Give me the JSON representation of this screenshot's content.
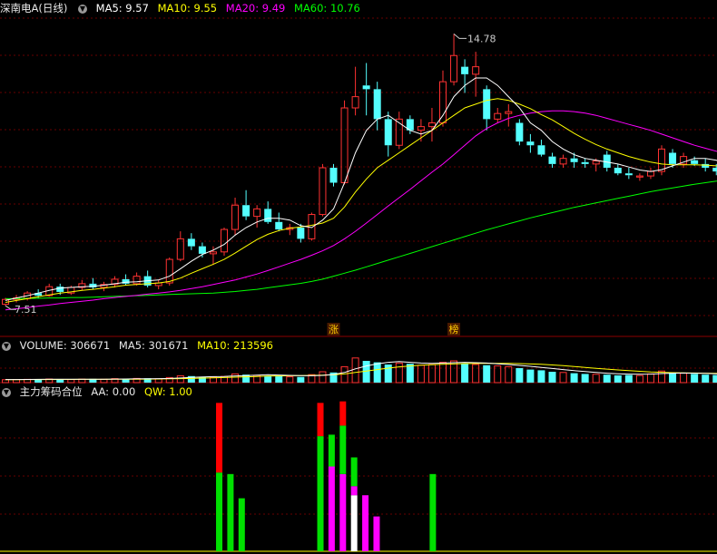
{
  "main_panel": {
    "title": "深南电A(日线)",
    "ma5": "MA5: 9.57",
    "ma10": "MA10: 9.55",
    "ma20": "MA20: 9.49",
    "ma60": "MA60: 10.76",
    "high_label": "14.78",
    "low_label": "7.51",
    "markers": [
      "涨",
      "榜"
    ]
  },
  "volume_panel": {
    "label": "VOLUME: 306671",
    "ma5": "MA5: 301671",
    "ma10": "MA10: 213596"
  },
  "chip_panel": {
    "title": "主力筹码合位",
    "aa": "AA: 0.00",
    "qw": "QW: 1.00"
  },
  "colors": {
    "up": "#ff3232",
    "down": "#54ffff",
    "ma5": "#ffffff",
    "ma10": "#ffff00",
    "ma20": "#ff00ff",
    "ma60": "#00ff00",
    "grid": "#8b0000",
    "chip_red": "#ff0000",
    "chip_green": "#00e000",
    "chip_magenta": "#ff00ff",
    "chip_white": "#ffffff"
  },
  "chart_data": [
    {
      "type": "candlestick",
      "title": "深南电A(日线)",
      "ylim": [
        7.2,
        15.2
      ],
      "high": 14.78,
      "low": 7.51,
      "marker_labels": [
        {
          "text": "涨",
          "index": 30
        },
        {
          "text": "榜",
          "index": 41
        }
      ],
      "ohlc": [
        [
          7.55,
          7.72,
          7.51,
          7.68
        ],
        [
          7.68,
          7.8,
          7.6,
          7.72
        ],
        [
          7.7,
          7.9,
          7.65,
          7.85
        ],
        [
          7.85,
          7.95,
          7.7,
          7.78
        ],
        [
          7.78,
          8.1,
          7.75,
          8.02
        ],
        [
          8.02,
          8.1,
          7.8,
          7.88
        ],
        [
          7.85,
          8.05,
          7.8,
          8.0
        ],
        [
          8.0,
          8.2,
          7.92,
          8.1
        ],
        [
          8.1,
          8.25,
          7.95,
          8.0
        ],
        [
          8.0,
          8.15,
          7.9,
          8.08
        ],
        [
          8.08,
          8.3,
          8.0,
          8.22
        ],
        [
          8.22,
          8.35,
          8.05,
          8.1
        ],
        [
          8.1,
          8.4,
          8.05,
          8.3
        ],
        [
          8.3,
          8.45,
          8.0,
          8.05
        ],
        [
          8.05,
          8.2,
          7.95,
          8.12
        ],
        [
          8.12,
          8.8,
          8.05,
          8.75
        ],
        [
          8.75,
          9.5,
          8.7,
          9.3
        ],
        [
          9.3,
          9.45,
          9.0,
          9.1
        ],
        [
          9.1,
          9.2,
          8.8,
          8.9
        ],
        [
          8.9,
          9.1,
          8.6,
          8.95
        ],
        [
          8.95,
          9.6,
          8.85,
          9.55
        ],
        [
          9.55,
          10.4,
          9.4,
          10.2
        ],
        [
          10.2,
          10.6,
          9.8,
          9.9
        ],
        [
          9.9,
          10.2,
          9.6,
          10.1
        ],
        [
          10.1,
          10.3,
          9.7,
          9.75
        ],
        [
          9.75,
          10.0,
          9.5,
          9.55
        ],
        [
          9.55,
          9.7,
          9.4,
          9.6
        ],
        [
          9.6,
          9.7,
          9.2,
          9.3
        ],
        [
          9.3,
          10.0,
          9.25,
          9.95
        ],
        [
          9.95,
          11.3,
          9.9,
          11.2
        ],
        [
          11.2,
          11.3,
          10.7,
          10.8
        ],
        [
          10.8,
          13.0,
          10.75,
          12.8
        ],
        [
          12.8,
          13.9,
          12.6,
          13.1
        ],
        [
          13.4,
          14.0,
          12.6,
          13.3
        ],
        [
          13.3,
          13.5,
          12.2,
          12.5
        ],
        [
          12.5,
          12.7,
          11.5,
          11.8
        ],
        [
          11.8,
          12.7,
          11.7,
          12.5
        ],
        [
          12.5,
          12.6,
          12.1,
          12.2
        ],
        [
          12.2,
          12.5,
          11.9,
          12.3
        ],
        [
          12.3,
          12.8,
          11.9,
          12.4
        ],
        [
          12.4,
          13.8,
          12.3,
          13.5
        ],
        [
          13.5,
          14.78,
          13.4,
          14.2
        ],
        [
          13.9,
          14.1,
          13.2,
          13.7
        ],
        [
          13.7,
          14.3,
          13.1,
          13.9
        ],
        [
          13.3,
          13.4,
          12.2,
          12.5
        ],
        [
          12.5,
          12.8,
          12.4,
          12.65
        ],
        [
          12.65,
          12.9,
          12.3,
          12.7
        ],
        [
          12.4,
          12.5,
          11.8,
          11.9
        ],
        [
          11.9,
          12.1,
          11.6,
          11.8
        ],
        [
          11.8,
          11.95,
          11.5,
          11.55
        ],
        [
          11.5,
          11.6,
          11.2,
          11.3
        ],
        [
          11.3,
          11.55,
          11.2,
          11.45
        ],
        [
          11.45,
          11.6,
          11.2,
          11.35
        ],
        [
          11.35,
          11.45,
          11.2,
          11.3
        ],
        [
          11.3,
          11.45,
          11.1,
          11.38
        ],
        [
          11.55,
          11.65,
          11.1,
          11.2
        ],
        [
          11.2,
          11.3,
          11.0,
          11.05
        ],
        [
          11.05,
          11.2,
          10.9,
          11.0
        ],
        [
          10.95,
          11.05,
          10.85,
          10.98
        ],
        [
          10.98,
          11.2,
          10.9,
          11.1
        ],
        [
          11.1,
          11.8,
          11.0,
          11.7
        ],
        [
          11.6,
          11.7,
          11.2,
          11.3
        ],
        [
          11.3,
          11.6,
          11.2,
          11.5
        ],
        [
          11.4,
          11.5,
          11.25,
          11.3
        ],
        [
          11.3,
          11.45,
          11.1,
          11.2
        ],
        [
          11.2,
          11.3,
          11.0,
          11.1
        ],
        [
          11.0,
          11.05,
          10.7,
          10.75
        ],
        [
          10.75,
          10.9,
          10.6,
          10.82
        ],
        [
          10.72,
          10.8,
          10.5,
          10.55
        ],
        [
          10.55,
          10.7,
          10.45,
          10.65
        ],
        [
          10.6,
          10.65,
          10.4,
          10.45
        ],
        [
          10.35,
          10.45,
          10.25,
          10.3
        ],
        [
          10.3,
          10.55,
          10.25,
          10.5
        ]
      ],
      "ma5": [
        7.65,
        7.72,
        7.78,
        7.85,
        7.92,
        7.98,
        8.0,
        8.02,
        8.03,
        8.06,
        8.1,
        8.14,
        8.15,
        8.18,
        8.2,
        8.3,
        8.5,
        8.7,
        8.88,
        9.0,
        9.15,
        9.4,
        9.6,
        9.75,
        9.85,
        9.85,
        9.8,
        9.65,
        9.6,
        9.8,
        10.1,
        10.8,
        11.6,
        12.2,
        12.5,
        12.6,
        12.4,
        12.2,
        12.1,
        12.2,
        12.6,
        13.1,
        13.4,
        13.6,
        13.6,
        13.4,
        13.1,
        12.8,
        12.4,
        12.2,
        11.9,
        11.7,
        11.55,
        11.45,
        11.4,
        11.35,
        11.3,
        11.22,
        11.14,
        11.1,
        11.15,
        11.25,
        11.35,
        11.45,
        11.45,
        11.4,
        11.22,
        11.05,
        10.95,
        10.85,
        10.72,
        10.62,
        10.58
      ],
      "ma10": [
        7.6,
        7.65,
        7.7,
        7.75,
        7.8,
        7.85,
        7.88,
        7.92,
        7.95,
        7.98,
        8.02,
        8.06,
        8.08,
        8.1,
        8.12,
        8.16,
        8.25,
        8.38,
        8.5,
        8.62,
        8.75,
        8.92,
        9.1,
        9.28,
        9.42,
        9.52,
        9.58,
        9.62,
        9.66,
        9.72,
        9.85,
        10.15,
        10.55,
        10.9,
        11.2,
        11.4,
        11.6,
        11.8,
        12.0,
        12.2,
        12.4,
        12.6,
        12.8,
        12.9,
        13.0,
        13.05,
        13.0,
        12.9,
        12.78,
        12.62,
        12.48,
        12.3,
        12.12,
        11.96,
        11.82,
        11.7,
        11.6,
        11.5,
        11.42,
        11.35,
        11.3,
        11.28,
        11.28,
        11.28,
        11.27,
        11.25,
        11.22,
        11.18,
        11.12,
        11.05,
        10.98,
        10.9,
        10.82
      ],
      "ma20": [
        7.4,
        7.43,
        7.46,
        7.5,
        7.53,
        7.57,
        7.6,
        7.63,
        7.66,
        7.7,
        7.73,
        7.76,
        7.79,
        7.82,
        7.85,
        7.88,
        7.92,
        7.97,
        8.02,
        8.08,
        8.14,
        8.2,
        8.28,
        8.36,
        8.45,
        8.55,
        8.65,
        8.75,
        8.86,
        8.98,
        9.12,
        9.3,
        9.5,
        9.72,
        9.95,
        10.18,
        10.4,
        10.62,
        10.85,
        11.08,
        11.3,
        11.55,
        11.8,
        12.05,
        12.25,
        12.4,
        12.52,
        12.6,
        12.66,
        12.7,
        12.72,
        12.72,
        12.7,
        12.66,
        12.6,
        12.52,
        12.44,
        12.36,
        12.28,
        12.2,
        12.1,
        12.0,
        11.9,
        11.8,
        11.72,
        11.64,
        11.56,
        11.48,
        11.4,
        11.32,
        11.26,
        11.2,
        11.16
      ],
      "ma60": [
        7.7,
        7.7,
        7.71,
        7.71,
        7.72,
        7.72,
        7.73,
        7.73,
        7.74,
        7.75,
        7.76,
        7.77,
        7.78,
        7.79,
        7.8,
        7.81,
        7.82,
        7.83,
        7.84,
        7.85,
        7.87,
        7.89,
        7.92,
        7.95,
        7.99,
        8.03,
        8.07,
        8.11,
        8.16,
        8.22,
        8.3,
        8.38,
        8.46,
        8.55,
        8.64,
        8.73,
        8.82,
        8.91,
        9.0,
        9.09,
        9.18,
        9.27,
        9.36,
        9.45,
        9.54,
        9.62,
        9.7,
        9.78,
        9.86,
        9.93,
        10.0,
        10.07,
        10.14,
        10.2,
        10.26,
        10.32,
        10.38,
        10.44,
        10.5,
        10.56,
        10.61,
        10.66,
        10.71,
        10.76,
        10.8,
        10.84,
        10.88,
        10.91,
        10.94,
        10.96,
        10.98,
        10.99,
        11.0
      ]
    },
    {
      "type": "bar",
      "title": "VOLUME",
      "ylim": [
        0,
        400000
      ],
      "values": [
        40000,
        42000,
        45000,
        38000,
        50000,
        44000,
        42000,
        48000,
        52000,
        46000,
        55000,
        50000,
        58000,
        60000,
        52000,
        70000,
        95000,
        90000,
        80000,
        75000,
        85000,
        120000,
        110000,
        100000,
        95000,
        90000,
        80000,
        78000,
        110000,
        150000,
        140000,
        220000,
        340000,
        300000,
        280000,
        250000,
        270000,
        260000,
        240000,
        250000,
        280000,
        300000,
        260000,
        250000,
        240000,
        230000,
        220000,
        200000,
        180000,
        170000,
        150000,
        140000,
        130000,
        120000,
        115000,
        110000,
        100000,
        105000,
        98000,
        120000,
        160000,
        140000,
        130000,
        120000,
        110000,
        105000,
        100000,
        95000,
        90000,
        85000,
        80000,
        78000,
        75000
      ],
      "ma5": [
        42000,
        43000,
        44000,
        45000,
        46000,
        46000,
        46000,
        47000,
        48000,
        48000,
        49000,
        50000,
        52000,
        54000,
        55000,
        58000,
        64000,
        72000,
        78000,
        82000,
        85000,
        92000,
        98000,
        104000,
        110000,
        105000,
        100000,
        96000,
        95000,
        100000,
        112000,
        140000,
        190000,
        230000,
        260000,
        280000,
        290000,
        280000,
        270000,
        265000,
        270000,
        275000,
        280000,
        275000,
        270000,
        260000,
        250000,
        238000,
        225000,
        210000,
        195000,
        180000,
        165000,
        152000,
        140000,
        130000,
        122000,
        118000,
        115000,
        118000,
        125000,
        130000,
        132000,
        130000,
        128000,
        122000,
        116000,
        110000,
        104000,
        98000,
        92000,
        88000,
        85000
      ],
      "ma10": [
        40000,
        41000,
        42000,
        42500,
        43000,
        43500,
        44000,
        44500,
        45000,
        45500,
        46000,
        47000,
        48000,
        49000,
        50000,
        52000,
        55000,
        58000,
        62000,
        66000,
        70000,
        75000,
        80000,
        85000,
        90000,
        93000,
        95000,
        97000,
        100000,
        103000,
        108000,
        120000,
        140000,
        160000,
        180000,
        200000,
        218000,
        230000,
        240000,
        248000,
        254000,
        258000,
        262000,
        264000,
        265000,
        266000,
        265000,
        262000,
        258000,
        252000,
        244000,
        234000,
        222000,
        210000,
        198000,
        186000,
        175000,
        165000,
        156000,
        148000,
        142000,
        138000,
        135000,
        132000,
        130000,
        128000,
        125000,
        122000,
        118000,
        114000,
        110000,
        106000,
        102000
      ],
      "series_names": [
        "VOLUME",
        "MA5",
        "MA10"
      ]
    },
    {
      "type": "bar",
      "title": "主力筹码合位",
      "ylim": [
        0,
        1.0
      ],
      "bars": [
        {
          "index": 19,
          "segments": [
            {
              "color": "green",
              "value": 0.52
            },
            {
              "color": "red",
              "value": 0.46
            }
          ]
        },
        {
          "index": 20,
          "segments": [
            {
              "color": "green",
              "value": 0.51
            }
          ]
        },
        {
          "index": 21,
          "segments": [
            {
              "color": "green",
              "value": 0.35
            }
          ]
        },
        {
          "index": 28,
          "segments": [
            {
              "color": "green",
              "value": 0.76
            },
            {
              "color": "red",
              "value": 0.22
            }
          ]
        },
        {
          "index": 29,
          "segments": [
            {
              "color": "magenta",
              "value": 0.56
            },
            {
              "color": "green",
              "value": 0.21
            }
          ]
        },
        {
          "index": 30,
          "segments": [
            {
              "color": "magenta",
              "value": 0.51
            },
            {
              "color": "green",
              "value": 0.32
            },
            {
              "color": "red",
              "value": 0.16
            }
          ]
        },
        {
          "index": 31,
          "segments": [
            {
              "color": "white",
              "value": 0.37
            },
            {
              "color": "magenta",
              "value": 0.06
            },
            {
              "color": "green",
              "value": 0.19
            }
          ]
        },
        {
          "index": 32,
          "segments": [
            {
              "color": "magenta",
              "value": 0.37
            }
          ]
        },
        {
          "index": 33,
          "segments": [
            {
              "color": "magenta",
              "value": 0.23
            }
          ]
        },
        {
          "index": 38,
          "segments": [
            {
              "color": "green",
              "value": 0.51
            }
          ]
        }
      ]
    }
  ]
}
